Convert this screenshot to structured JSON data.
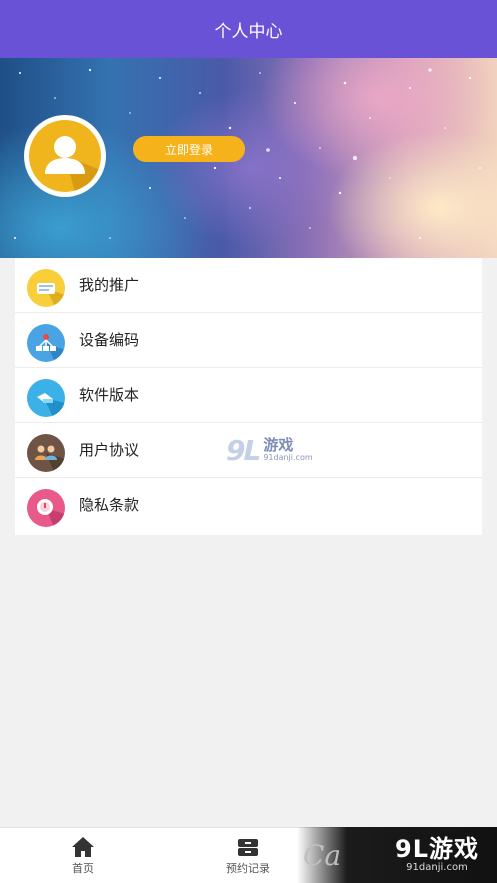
{
  "header": {
    "title": "个人中心"
  },
  "profile": {
    "avatar_icon": "user-silhouette-icon",
    "login_label": "立即登录"
  },
  "menu": {
    "items": [
      {
        "label": "我的推广",
        "icon": "promotion-icon",
        "color": "#f8cf3a"
      },
      {
        "label": "设备编码",
        "icon": "device-network-icon",
        "color": "#4aa4e3"
      },
      {
        "label": "软件版本",
        "icon": "version-icon",
        "color": "#3cb1e8"
      },
      {
        "label": "用户协议",
        "icon": "users-agreement-icon",
        "color": "#6f5446"
      },
      {
        "label": "隐私条款",
        "icon": "privacy-icon",
        "color": "#e85a8a"
      }
    ]
  },
  "tabbar": {
    "tabs": [
      {
        "label": "首页",
        "icon": "home-icon"
      },
      {
        "label": "预约记录",
        "icon": "records-icon"
      }
    ]
  },
  "watermark": {
    "logo": "9L",
    "name": "游戏",
    "url": "91danji.com"
  },
  "corner_badge": {
    "logo": "9L",
    "name": "游戏",
    "url": "91danji.com"
  }
}
